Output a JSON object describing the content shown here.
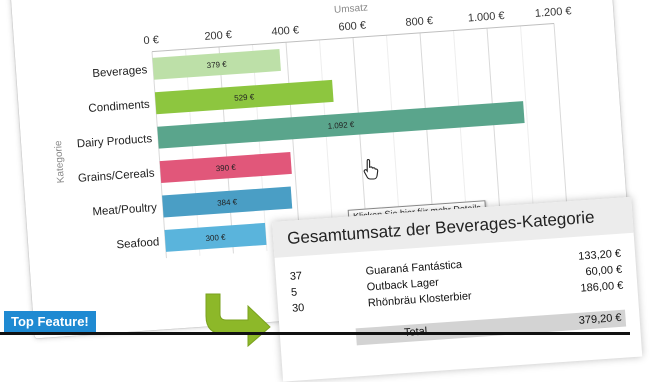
{
  "chart_data": {
    "type": "bar",
    "orientation": "horizontal",
    "title": "",
    "xlabel": "Umsatz",
    "ylabel": "Kategorie",
    "categories": [
      "Beverages",
      "Condiments",
      "Dairy Products",
      "Grains/Cereals",
      "Meat/Poultry",
      "Seafood"
    ],
    "values": [
      379,
      529,
      1092,
      390,
      384,
      300
    ],
    "value_labels": [
      "379 €",
      "529 €",
      "1.092 €",
      "390 €",
      "384 €",
      "300 €"
    ],
    "bar_colors": [
      "#bde0a8",
      "#8dc63f",
      "#5aa58c",
      "#e1577a",
      "#4a9ec5",
      "#5ab4dc"
    ],
    "xlim": [
      0,
      1200
    ],
    "x_ticks": [
      0,
      200,
      400,
      600,
      800,
      1000,
      1200
    ],
    "x_tick_labels": [
      "0 €",
      "200 €",
      "400 €",
      "600 €",
      "800 €",
      "1.000 €",
      "1.200 €"
    ],
    "grid": true,
    "legend": "none"
  },
  "tooltip": {
    "text": "Klicken Sie hier für mehr Details"
  },
  "detail": {
    "title": "Gesamtumsatz der Beverages-Kategorie",
    "rows": [
      {
        "qty": "37",
        "name": "Guaraná Fantástica",
        "amount": "133,20 €"
      },
      {
        "qty": "5",
        "name": "Outback Lager",
        "amount": "60,00 €"
      },
      {
        "qty": "30",
        "name": "Rhönbräu Klosterbier",
        "amount": "186,00 €"
      }
    ],
    "total_label": "Total",
    "total_amount": "379,20 €"
  },
  "badge": {
    "text": "Top Feature!"
  },
  "colors": {
    "accent": "#1f8ad2",
    "arrow": "#8db829",
    "detail_header": "#ececec",
    "total_bg": "#d3d3d3"
  }
}
